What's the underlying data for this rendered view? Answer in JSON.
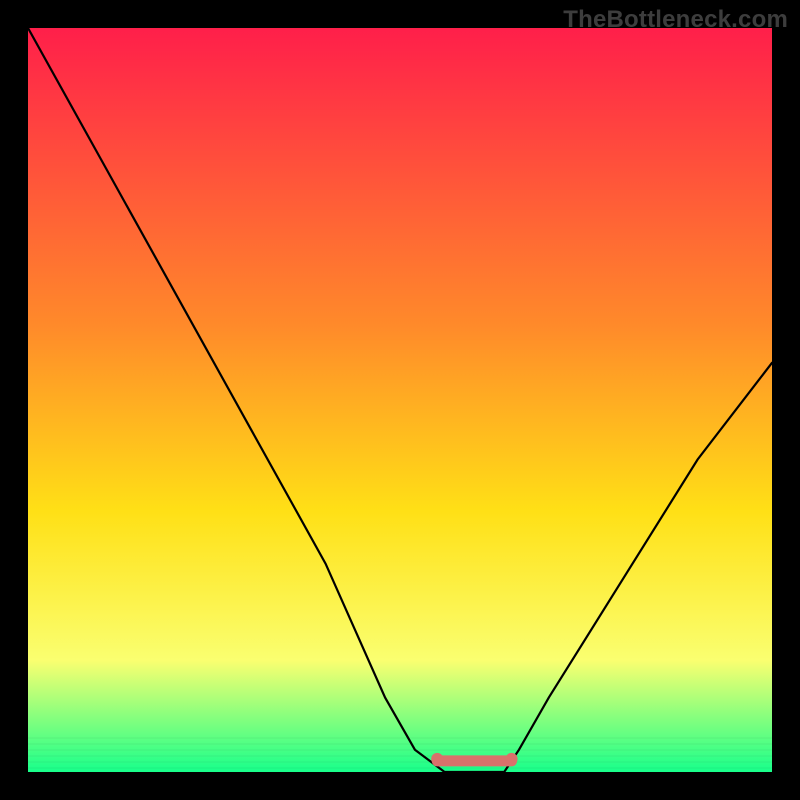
{
  "watermark": {
    "text": "TheBottleneck.com"
  },
  "chart_data": {
    "type": "line",
    "title": "",
    "xlabel": "",
    "ylabel": "",
    "xlim": [
      0,
      100
    ],
    "ylim": [
      0,
      100
    ],
    "series": [
      {
        "name": "curve",
        "x": [
          0,
          10,
          20,
          30,
          40,
          48,
          52,
          56,
          58,
          60,
          64,
          66,
          70,
          80,
          90,
          100
        ],
        "y": [
          100,
          82,
          64,
          46,
          28,
          10,
          3,
          0,
          0,
          0,
          0,
          3,
          10,
          26,
          42,
          55
        ]
      }
    ],
    "highlight_band": {
      "x_start": 55,
      "x_end": 65,
      "y_center": 1.5
    }
  },
  "colors": {
    "gradient_top": "#ff1f4a",
    "gradient_mid1": "#ff8a2a",
    "gradient_mid2": "#ffe016",
    "gradient_mid3": "#faff70",
    "gradient_bottom": "#18ff8b",
    "curve": "#000000",
    "highlight": "#d9716b",
    "frame": "#000000"
  }
}
